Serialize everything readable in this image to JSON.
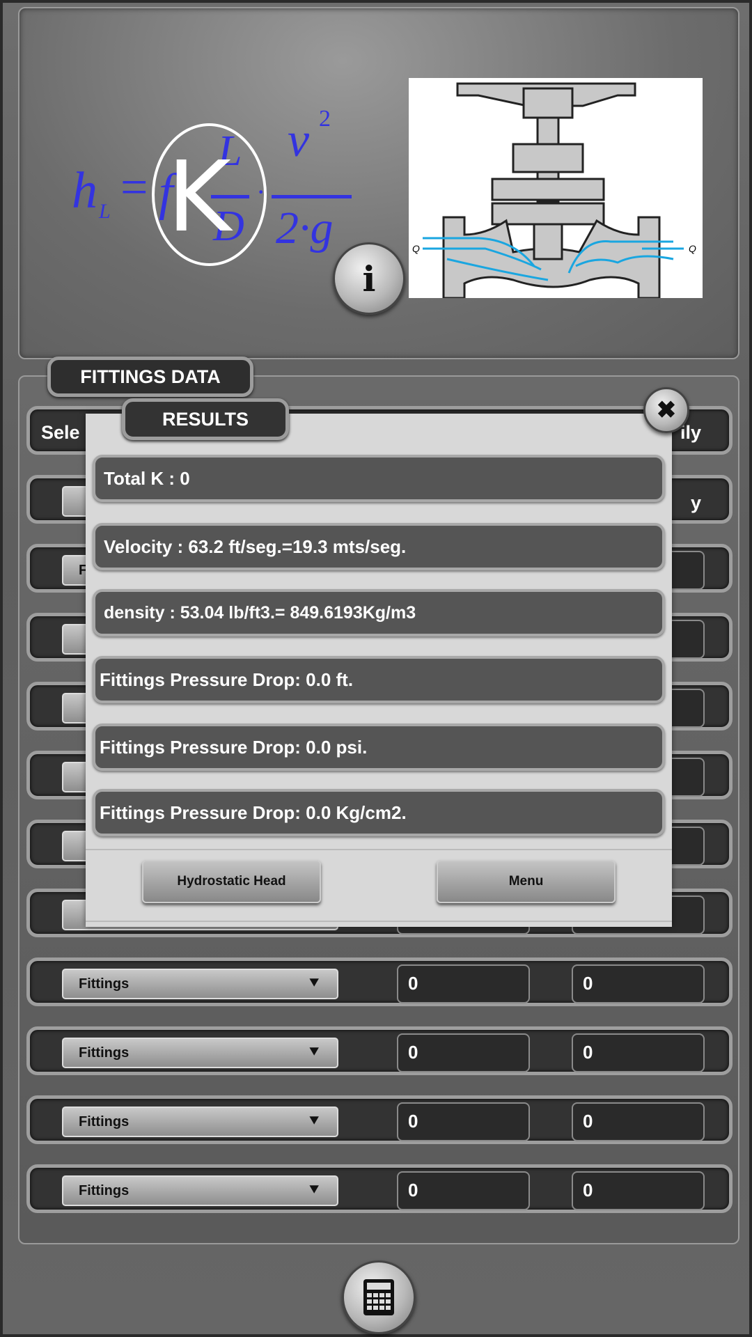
{
  "formula": {
    "lhs": "h",
    "lhs_sub": "L",
    "eq": "=",
    "f": "f",
    "num1": "L",
    "den1": "D",
    "num2": "v",
    "num2_sup": "2",
    "den2": "2·g",
    "overlay": "K"
  },
  "image": {
    "flow_label_in": "Q",
    "flow_label_out": "Q"
  },
  "info_button": {
    "icon": "info-icon",
    "label": "i"
  },
  "fittings": {
    "tab_label": "FITTINGS DATA",
    "header": {
      "left": "Sele",
      "right": "ily"
    },
    "rows": [
      {
        "fitting": "Fittings",
        "value1": "0",
        "value2": "0"
      },
      {
        "fitting": "Fittings",
        "value1": "0",
        "value2": "0"
      },
      {
        "fitting": "Fittings",
        "value1": "0",
        "value2": "0"
      },
      {
        "fitting": "Fittings",
        "value1": "0",
        "value2": "0"
      }
    ],
    "partial_row_left": "F",
    "partial_row_right": "y"
  },
  "results": {
    "tab_label": "RESULTS",
    "close_icon": "close-icon",
    "lines": [
      "Total K : 0",
      "Velocity :   63.2 ft/seg.=19.3 mts/seg.",
      "density : 53.04 lb/ft3.= 849.6193Kg/m3",
      "Fittings Pressure Drop: 0.0  ft.",
      "Fittings Pressure Drop: 0.0 psi.",
      "Fittings Pressure Drop: 0.0 Kg/cm2."
    ],
    "buttons": {
      "hydrostatic": "Hydrostatic Head",
      "menu": "Menu"
    }
  },
  "calculator_button": {
    "icon": "calculator-icon"
  },
  "colors": {
    "formula": "#3333e0",
    "flow_arrows": "#1aa6e0",
    "dialog": "#d8d8d8"
  }
}
